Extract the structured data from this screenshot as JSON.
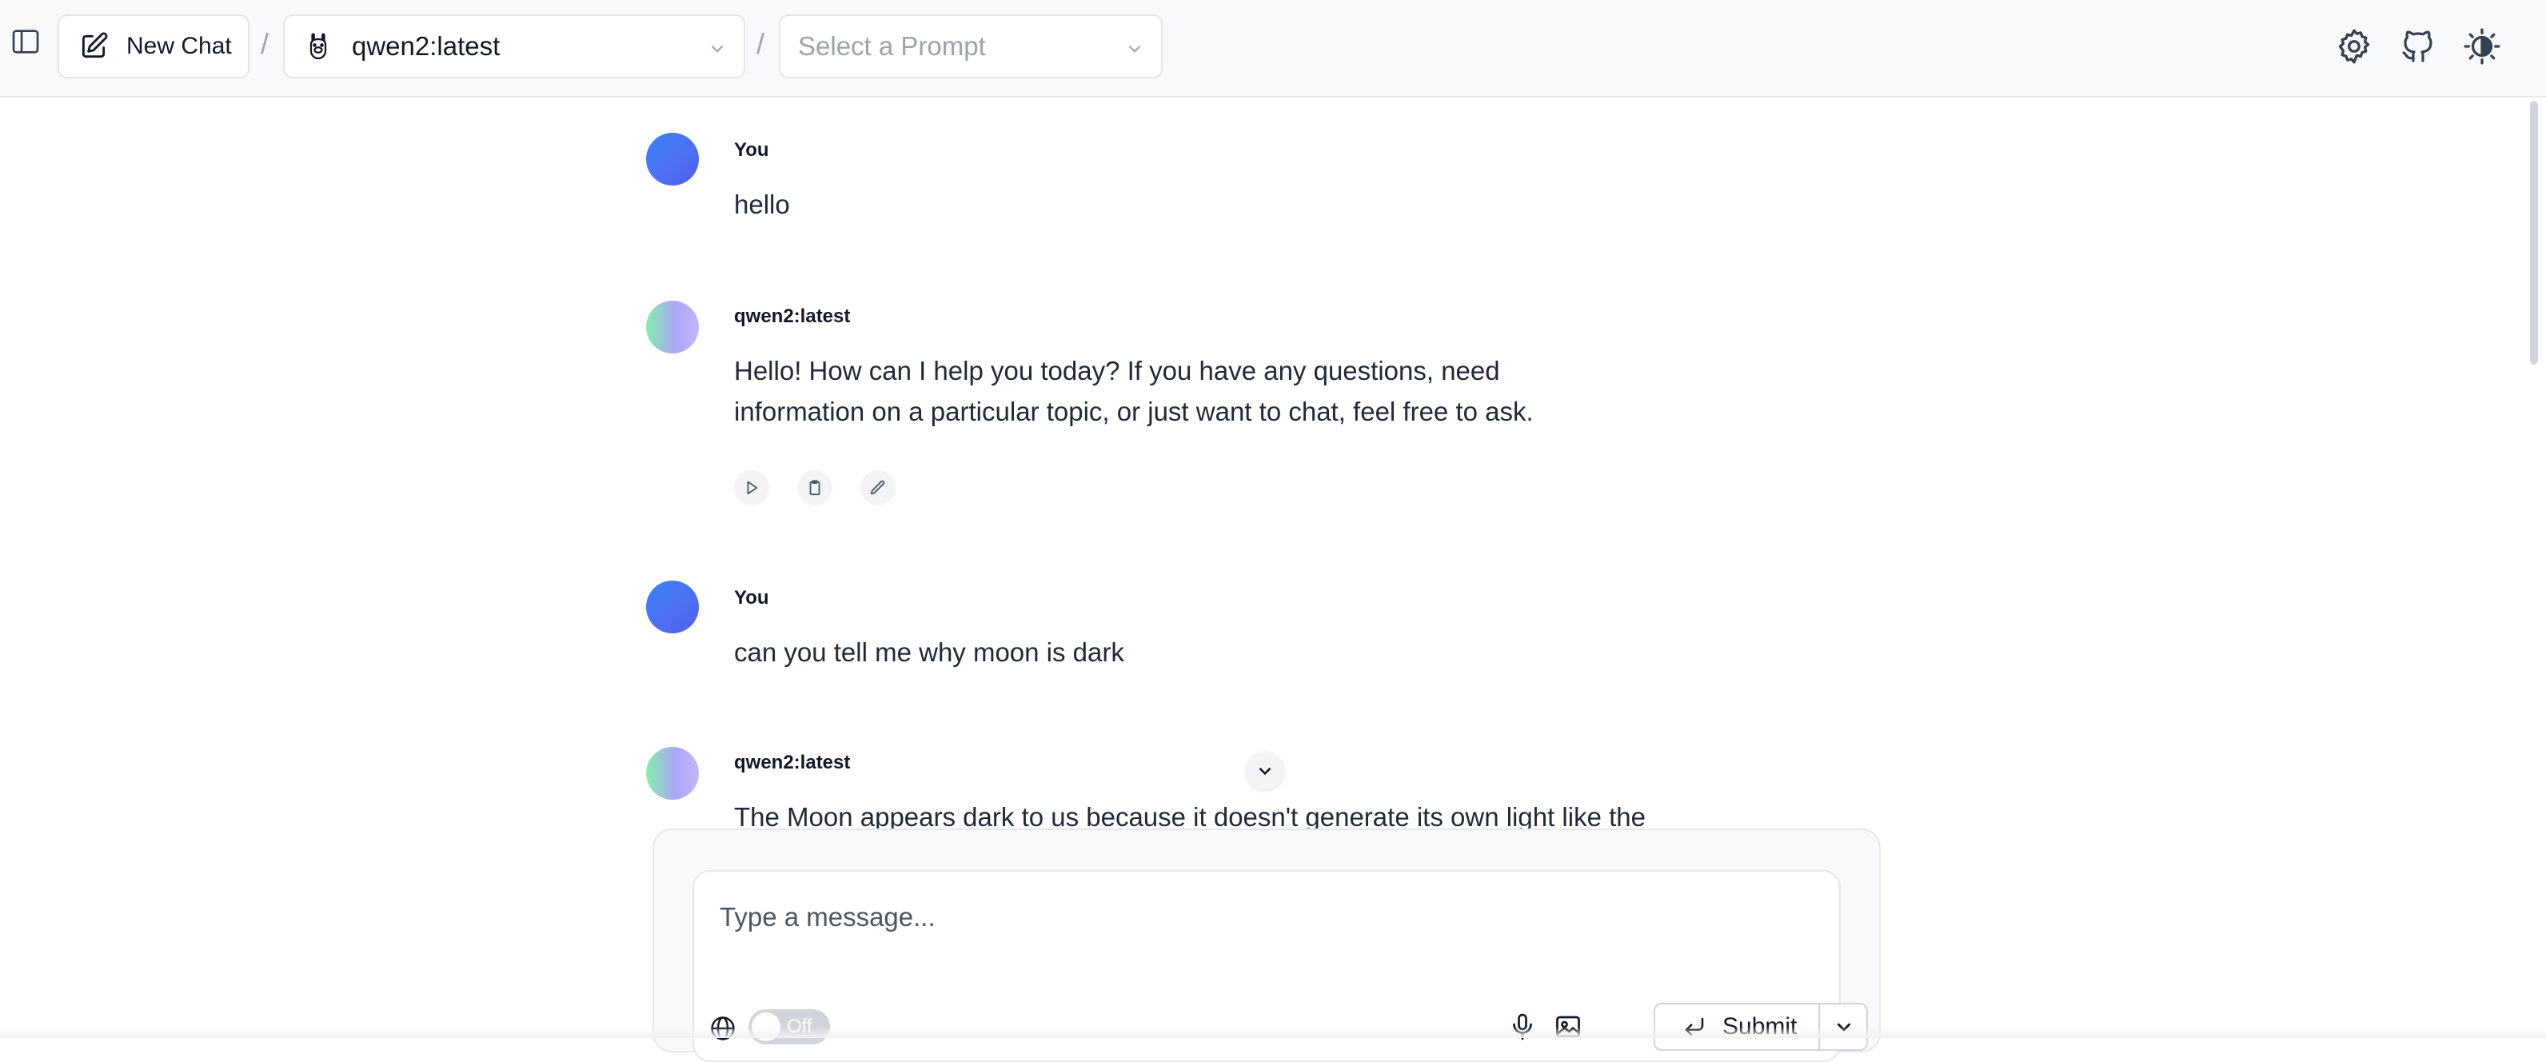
{
  "header": {
    "new_chat_label": "New Chat",
    "separator": "/",
    "model": "qwen2:latest",
    "prompt_placeholder": "Select a Prompt"
  },
  "messages": [
    {
      "role": "user",
      "author": "You",
      "text": "hello"
    },
    {
      "role": "assistant",
      "author": "qwen2:latest",
      "text": "Hello! How can I help you today? If you have any questions, need information on a particular topic, or just want to chat, feel free to ask."
    },
    {
      "role": "user",
      "author": "You",
      "text": "can you tell me why moon is dark"
    },
    {
      "role": "assistant",
      "author": "qwen2:latest",
      "text": "The Moon appears dark to us because it doesn't generate its own light like the"
    }
  ],
  "composer": {
    "placeholder": "Type a message...",
    "web_toggle_label": "Off",
    "submit_label": "Submit"
  },
  "icons": {
    "sidebar": "sidebar-panel-icon",
    "new_chat": "edit-square-icon",
    "model": "llama-icon",
    "settings": "gear-icon",
    "github": "github-icon",
    "theme": "sun-gear-icon"
  },
  "colors": {
    "user_avatar": "#3b82f6",
    "assistant_avatar_start": "#86efac",
    "assistant_avatar_end": "#c4b5fd",
    "header_bg": "#f8f9fb"
  }
}
